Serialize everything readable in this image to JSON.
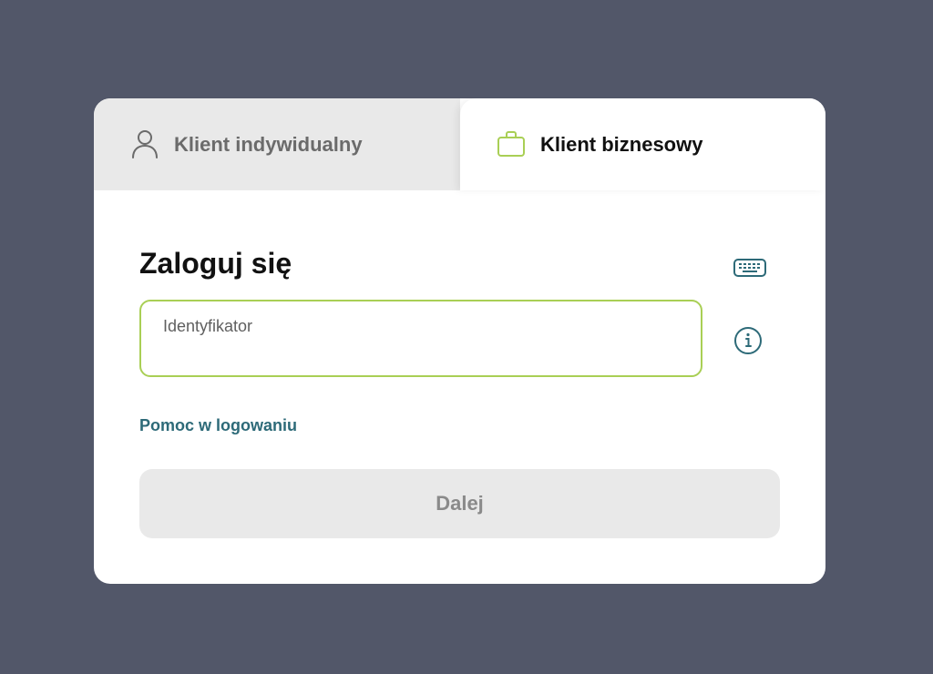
{
  "tabs": [
    {
      "label": "Klient indywidualny",
      "icon": "person-icon",
      "active": false
    },
    {
      "label": "Klient biznesowy",
      "icon": "briefcase-icon",
      "active": true
    }
  ],
  "login": {
    "title": "Zaloguj się",
    "identifier": {
      "label": "Identyfikator",
      "value": ""
    },
    "help_link": "Pomoc w logowaniu",
    "next_button": "Dalej"
  },
  "icons": {
    "keyboard": "keyboard-icon",
    "info": "info-icon"
  },
  "colors": {
    "background": "#525769",
    "accent_green": "#a9cf55",
    "link_teal": "#2d6a78",
    "inactive_tab": "#e9e9e9"
  }
}
